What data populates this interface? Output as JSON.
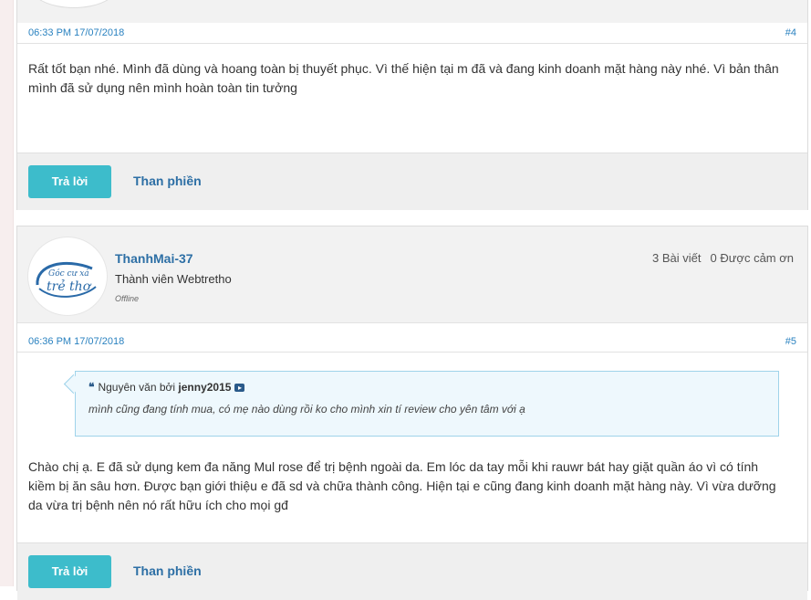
{
  "post4": {
    "date": "06:33 PM 17/07/2018",
    "number": "#4",
    "content": "Rất tốt bạn nhé. Mình đã dùng và hoang toàn bị thuyết phục. Vì thế hiện tại m đã và đang kinh doanh mặt hàng này nhé. Vì bản thân mình đã sử dụng nên mình hoàn toàn tin tưởng",
    "reply_label": "Trả lời",
    "complain_label": "Than phiền"
  },
  "post5": {
    "username": "ThanhMai-37",
    "rank": "Thành viên Webtretho",
    "status": "Offline",
    "posts_count": "3 Bài viết",
    "thanks_count": "0 Được cảm ơn",
    "date": "06:36 PM 17/07/2018",
    "number": "#5",
    "quote": {
      "prefix": "Nguyên văn bởi",
      "author": "jenny2015",
      "text": "mình cũng đang tính mua, có mẹ nào dùng rồi ko cho mình xin tí review cho yên tâm với ạ"
    },
    "content": "Chào chị ạ. E đã sử dụng kem đa năng Mul rose để trị bệnh ngoài da. Em lóc da tay mỗi khi rauwr bát hay giặt quần áo vì có tính kiềm bị ăn sâu hơn. Được bạn giới thiệu e đã sd và chữa thành công. Hiện tại e cũng đang kinh doanh mặt hàng này. Vì vừa dưỡng da vừa trị bệnh nên nó rất hữu ích cho mọi gđ",
    "reply_label": "Trả lời",
    "complain_label": "Than phiền",
    "avatar_text_line1": "Góc cư xá",
    "avatar_text_line2": "trẻ thơ"
  },
  "colors": {
    "reply_button": "#3dbccb",
    "link": "#2d6fa5",
    "meta": "#2a82c0"
  }
}
